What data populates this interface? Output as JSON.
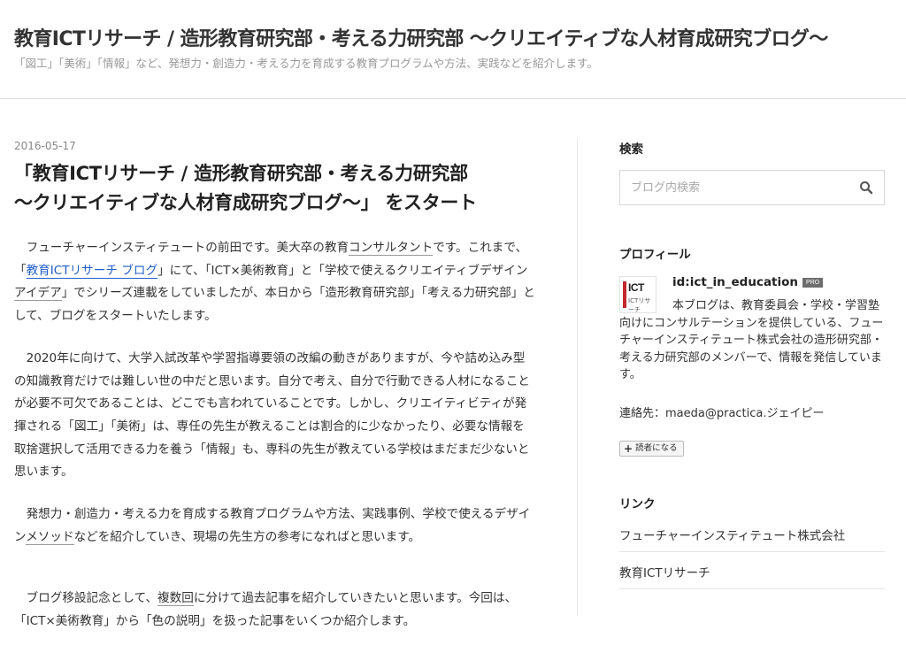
{
  "header": {
    "title": "教育ICTリサーチ / 造形教育研究部・考える力研究部 〜クリエイティブな人材育成研究ブログ〜",
    "description": "「図工」「美術」「情報」など、発想力・創造力・考える力を育成する教育プログラムや方法、実践などを紹介します。"
  },
  "entry": {
    "date": "2016-05-17",
    "title_line1": "「教育ICTリサーチ / 造形教育研究部・考える力研究部",
    "title_line2": "〜クリエイティブな人材育成研究ブログ〜」 をスタート",
    "p1": {
      "t1": "　フューチャーインスティテュートの前田です。美大卒の教育",
      "kw1": "コンサルタント",
      "t2": "です。これまで、「",
      "link": "教育ICTリサーチ ブログ",
      "t3": "」にて、「ICT×美術教育」と「学校で使えるクリエイティブデザイン",
      "kw2": "アイデア",
      "t4": "」でシリーズ連載をしていましたが、本日から「造形教育研究部」「考える力研究部」として、ブログをスタートいたします。"
    },
    "p2": "　2020年に向けて、大学入試改革や学習指導要領の改編の動きがありますが、今や詰め込み型の知識教育だけでは難しい世の中だと思います。自分で考え、自分で行動できる人材になることが必要不可欠であることは、どこでも言われていることです。しかし、クリエイティビティが発揮される「図工」「美術」は、専任の先生が教えることは割合的に少なかったり、必要な情報を取捨選択して活用できる力を養う「情報」も、専科の先生が教えている学校はまだまだ少ないと思います。",
    "p3": {
      "t1": "　発想力・創造力・考える力を育成する教育プログラムや方法、実践事例、学校で使えるデザイン",
      "kw": "メソッド",
      "t2": "などを紹介していき、現場の先生方の参考になればと思います。"
    },
    "p4": {
      "t1": "　ブログ移設記念として、",
      "kw": "複数回",
      "t2": "に分けて過去記事を紹介していきたいと思います。今回は、「ICT×美術教育」から「色の説明」を扱った記事をいくつか紹介します。"
    }
  },
  "sidebar": {
    "search": {
      "title": "検索",
      "placeholder": "ブログ内検索",
      "icon": "search-icon"
    },
    "profile": {
      "title": "プロフィール",
      "avatar_text_1": "ICT",
      "avatar_text_2": "ICTリサーチ",
      "id": "id:ict_in_education",
      "badge": "PRO",
      "text": "本ブログは、教育委員会・学校・学習塾向けにコンサルテーションを提供している、フューチャーインスティテュート株式会社の造形研究部・考える力研究部のメンバーで、情報を発信しています。",
      "contact": "連絡先：maeda@practica.ジェイピー",
      "reader_button": "読者になる"
    },
    "links": {
      "title": "リンク",
      "items": [
        "フューチャーインスティテュート株式会社",
        "教育ICTリサーチ"
      ]
    }
  }
}
